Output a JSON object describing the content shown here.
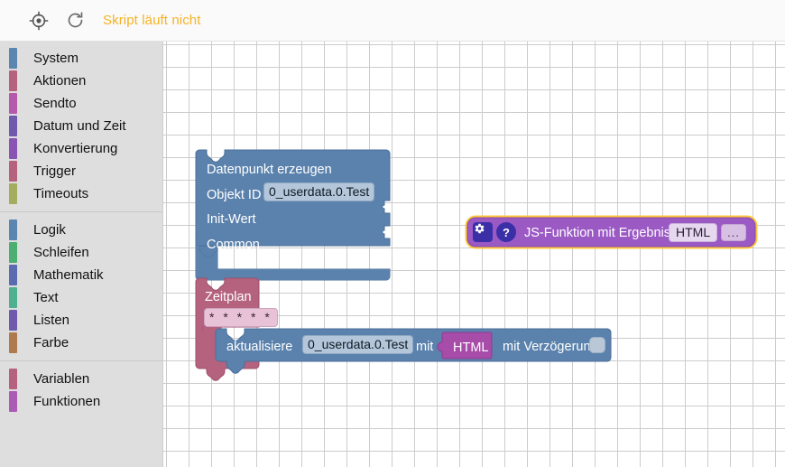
{
  "toolbar": {
    "center_icon": "crosshair-target-icon",
    "reload_icon": "refresh-icon",
    "status_text": "Skript läuft nicht",
    "status_color": "#f5b324"
  },
  "toolbox": {
    "groups": [
      {
        "items": [
          {
            "label": "System",
            "color": "#5b86b0"
          },
          {
            "label": "Aktionen",
            "color": "#b5627f"
          },
          {
            "label": "Sendto",
            "color": "#b559ab"
          },
          {
            "label": "Datum und Zeit",
            "color": "#6f5bab"
          },
          {
            "label": "Konvertierung",
            "color": "#8a54b5"
          },
          {
            "label": "Trigger",
            "color": "#b5627f"
          },
          {
            "label": "Timeouts",
            "color": "#a4ac5f"
          }
        ]
      },
      {
        "items": [
          {
            "label": "Logik",
            "color": "#5b86b0"
          },
          {
            "label": "Schleifen",
            "color": "#4caf72"
          },
          {
            "label": "Mathematik",
            "color": "#5b6bb0"
          },
          {
            "label": "Text",
            "color": "#4fb08f"
          },
          {
            "label": "Listen",
            "color": "#6f5bab"
          },
          {
            "label": "Farbe",
            "color": "#b07a4f"
          }
        ]
      },
      {
        "items": [
          {
            "label": "Variablen",
            "color": "#b5627f"
          },
          {
            "label": "Funktionen",
            "color": "#ac5bb5"
          }
        ]
      }
    ]
  },
  "workspace": {
    "grid_spacing": 25,
    "grid_color": "#c4c4c4",
    "background": "#ffffff",
    "blocks": {
      "create_state": {
        "name": "Datenpunkt erzeugen",
        "color": "#5b82ad",
        "title": "Datenpunkt erzeugen",
        "rows": [
          {
            "label": "Objekt ID",
            "value": "0_userdata.0.Test"
          },
          {
            "label": "Init-Wert",
            "value": ""
          },
          {
            "label": "Common",
            "value": ""
          }
        ]
      },
      "js_function": {
        "name": "JS-Funktion mit Ergebnis",
        "color": "#9b59c4",
        "highlight_color": "#ffc83d",
        "label": "JS-Funktion mit Ergebnis",
        "result_badge": "HTML",
        "ellipsis": "...",
        "gear_icon": "gear-icon",
        "help_icon": "help-icon"
      },
      "schedule": {
        "name": "Zeitplan",
        "color": "#b5627f",
        "label": "Zeitplan",
        "cron_value": "* * * * *"
      },
      "update_state": {
        "name": "aktualisiere",
        "color": "#5b82ad",
        "prefix": "aktualisiere",
        "object_id": "0_userdata.0.Test",
        "with_label": "mit",
        "value_badge": "HTML",
        "delay_label": "mit Verzögerung",
        "delay_value": ""
      }
    }
  }
}
